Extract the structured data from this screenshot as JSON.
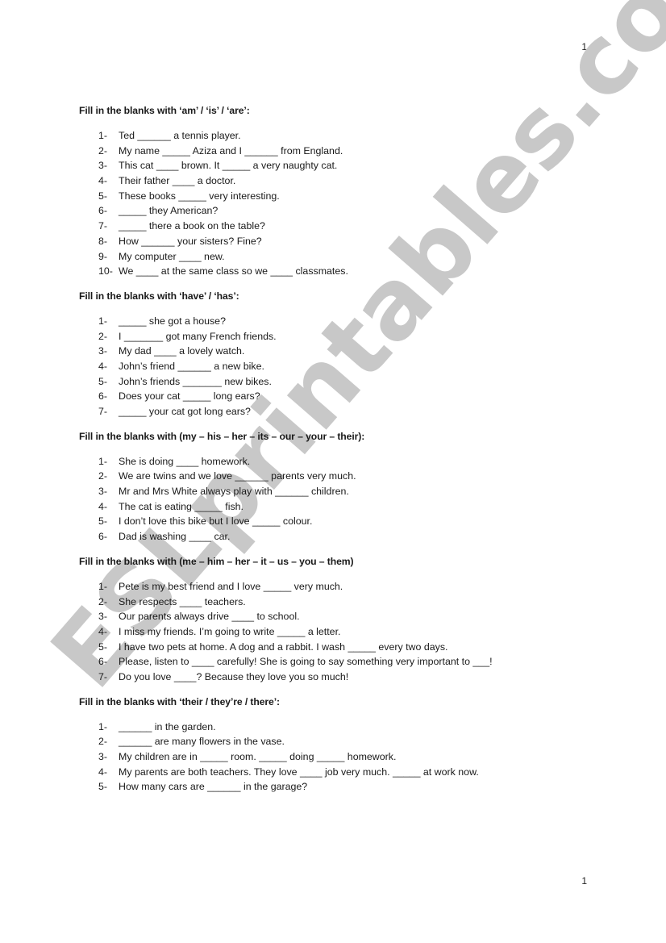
{
  "page_number_top": "1",
  "page_number_bottom": "1",
  "watermark": "ESLprintables.com",
  "sections": [
    {
      "title": "Fill in the blanks with ‘am’ / ‘is’ / ‘are’:",
      "items": [
        {
          "num": "1-",
          "text": "Ted ______ a  tennis player."
        },
        {
          "num": "2-",
          "text": "My name _____ Aziza and I ______ from England."
        },
        {
          "num": "3-",
          "text": "This cat ____ brown. It _____ a very naughty cat."
        },
        {
          "num": "4-",
          "text": "Their father ____ a doctor."
        },
        {
          "num": "5-",
          "text": "These books _____ very interesting."
        },
        {
          "num": "6-",
          "text": "_____ they American?"
        },
        {
          "num": "7-",
          "text": "_____ there a book on the table?"
        },
        {
          "num": "8-",
          "text": "How ______ your sisters? Fine?"
        },
        {
          "num": "9-",
          "text": "My computer ____ new."
        },
        {
          "num": "10-",
          "text": "We ____ at the same class so we ____ classmates."
        }
      ]
    },
    {
      "title": "Fill in the blanks with ‘have’ / ‘has’:",
      "items": [
        {
          "num": "1-",
          "text": "_____ she got a house?"
        },
        {
          "num": "2-",
          "text": "I _______ got many French friends."
        },
        {
          "num": "3-",
          "text": "My dad ____ a lovely watch."
        },
        {
          "num": "4-",
          "text": "John’s friend ______ a new bike."
        },
        {
          "num": "5-",
          "text": "John’s friends _______ new bikes."
        },
        {
          "num": "6-",
          "text": "Does your cat _____ long ears?"
        },
        {
          "num": "7-",
          "text": "_____ your cat got long ears?"
        }
      ]
    },
    {
      "title": "Fill in the blanks with (my – his – her – its – our – your – their):",
      "items": [
        {
          "num": "1-",
          "text": "She is doing ____ homework."
        },
        {
          "num": "2-",
          "text": "We are twins and we love ______ parents very much."
        },
        {
          "num": "3-",
          "text": "Mr and Mrs White always play with ______ children."
        },
        {
          "num": "4-",
          "text": "The cat is eating _____ fish."
        },
        {
          "num": "5-",
          "text": "I don’t love this bike but I love _____ colour."
        },
        {
          "num": "6-",
          "text": "Dad is washing ____ car."
        }
      ]
    },
    {
      "title": "Fill in the blanks with (me – him – her – it – us – you – them)",
      "items": [
        {
          "num": "1-",
          "text": "Pete is my best friend and I love _____ very much."
        },
        {
          "num": "2-",
          "text": "She respects ____ teachers."
        },
        {
          "num": "3-",
          "text": "Our parents always drive ____ to school."
        },
        {
          "num": "4-",
          "text": "I miss my friends. I’m going to write _____ a letter."
        },
        {
          "num": "5-",
          "text": "I have two pets at home. A dog and a rabbit. I wash _____ every two days."
        },
        {
          "num": "6-",
          "text": "Please, listen to ____ carefully! She is going to say something very important to ___!"
        },
        {
          "num": "7-",
          "text": "Do you love ____? Because they love you so much!"
        }
      ]
    },
    {
      "title": "Fill in the blanks with ‘their / they’re / there’:",
      "items": [
        {
          "num": "1-",
          "text": "______ in the garden."
        },
        {
          "num": "2-",
          "text": "______ are many flowers in the vase."
        },
        {
          "num": "3-",
          "text": "My children are in _____ room. _____ doing _____ homework."
        },
        {
          "num": "4-",
          "text": "My parents are both teachers. They love ____ job very much. _____ at work now."
        },
        {
          "num": "5-",
          "text": "How many cars are ______ in the garage?"
        }
      ]
    }
  ]
}
